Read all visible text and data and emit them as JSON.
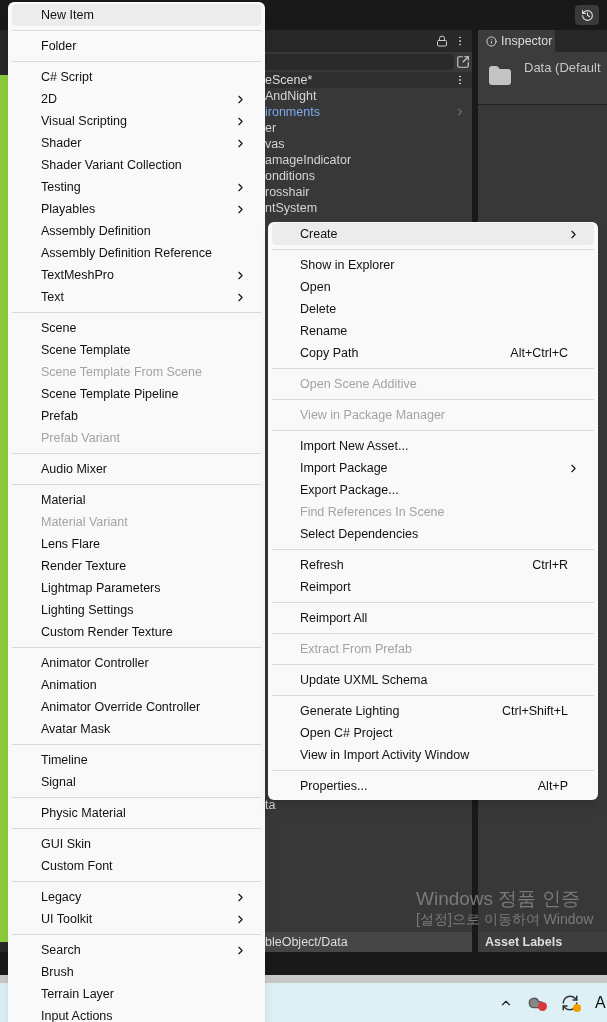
{
  "hierarchy": {
    "scene": "eScene*",
    "rows": [
      {
        "label": "AndNight",
        "kind": "object",
        "expandable": false
      },
      {
        "label": "ironments",
        "kind": "prefab",
        "expandable": true
      },
      {
        "label": "er",
        "kind": "object",
        "expandable": false
      },
      {
        "label": "vas",
        "kind": "object",
        "expandable": false
      },
      {
        "label": "amageIndicator",
        "kind": "object",
        "expandable": false
      },
      {
        "label": "onditions",
        "kind": "object",
        "expandable": false
      },
      {
        "label": "rosshair",
        "kind": "object",
        "expandable": false
      },
      {
        "label": "ntSystem",
        "kind": "object",
        "expandable": false
      }
    ],
    "lower_rows": [
      "ta"
    ],
    "path": "bleObject/Data"
  },
  "inspector": {
    "tab": "Inspector",
    "title": "Data (Default",
    "footer": "Asset Labels"
  },
  "activation_notice": [
    "Windows 정품 인증",
    "[설정]으로 이동하여 Window"
  ],
  "taskbar": {
    "clock_partial": "A"
  },
  "create_menu": [
    [
      {
        "label": "New Item",
        "highlighted": true,
        "disabled": false,
        "submenu": false
      }
    ],
    [
      {
        "label": "Folder",
        "highlighted": false,
        "disabled": false,
        "submenu": false
      }
    ],
    [
      {
        "label": "C# Script",
        "highlighted": false,
        "disabled": false,
        "submenu": false
      },
      {
        "label": "2D",
        "highlighted": false,
        "disabled": false,
        "submenu": true
      },
      {
        "label": "Visual Scripting",
        "highlighted": false,
        "disabled": false,
        "submenu": true
      },
      {
        "label": "Shader",
        "highlighted": false,
        "disabled": false,
        "submenu": true
      },
      {
        "label": "Shader Variant Collection",
        "highlighted": false,
        "disabled": false,
        "submenu": false
      },
      {
        "label": "Testing",
        "highlighted": false,
        "disabled": false,
        "submenu": true
      },
      {
        "label": "Playables",
        "highlighted": false,
        "disabled": false,
        "submenu": true
      },
      {
        "label": "Assembly Definition",
        "highlighted": false,
        "disabled": false,
        "submenu": false
      },
      {
        "label": "Assembly Definition Reference",
        "highlighted": false,
        "disabled": false,
        "submenu": false
      },
      {
        "label": "TextMeshPro",
        "highlighted": false,
        "disabled": false,
        "submenu": true
      },
      {
        "label": "Text",
        "highlighted": false,
        "disabled": false,
        "submenu": true
      }
    ],
    [
      {
        "label": "Scene",
        "highlighted": false,
        "disabled": false,
        "submenu": false
      },
      {
        "label": "Scene Template",
        "highlighted": false,
        "disabled": false,
        "submenu": false
      },
      {
        "label": "Scene Template From Scene",
        "highlighted": false,
        "disabled": true,
        "submenu": false
      },
      {
        "label": "Scene Template Pipeline",
        "highlighted": false,
        "disabled": false,
        "submenu": false
      },
      {
        "label": "Prefab",
        "highlighted": false,
        "disabled": false,
        "submenu": false
      },
      {
        "label": "Prefab Variant",
        "highlighted": false,
        "disabled": true,
        "submenu": false
      }
    ],
    [
      {
        "label": "Audio Mixer",
        "highlighted": false,
        "disabled": false,
        "submenu": false
      }
    ],
    [
      {
        "label": "Material",
        "highlighted": false,
        "disabled": false,
        "submenu": false
      },
      {
        "label": "Material Variant",
        "highlighted": false,
        "disabled": true,
        "submenu": false
      },
      {
        "label": "Lens Flare",
        "highlighted": false,
        "disabled": false,
        "submenu": false
      },
      {
        "label": "Render Texture",
        "highlighted": false,
        "disabled": false,
        "submenu": false
      },
      {
        "label": "Lightmap Parameters",
        "highlighted": false,
        "disabled": false,
        "submenu": false
      },
      {
        "label": "Lighting Settings",
        "highlighted": false,
        "disabled": false,
        "submenu": false
      },
      {
        "label": "Custom Render Texture",
        "highlighted": false,
        "disabled": false,
        "submenu": false
      }
    ],
    [
      {
        "label": "Animator Controller",
        "highlighted": false,
        "disabled": false,
        "submenu": false
      },
      {
        "label": "Animation",
        "highlighted": false,
        "disabled": false,
        "submenu": false
      },
      {
        "label": "Animator Override Controller",
        "highlighted": false,
        "disabled": false,
        "submenu": false
      },
      {
        "label": "Avatar Mask",
        "highlighted": false,
        "disabled": false,
        "submenu": false
      }
    ],
    [
      {
        "label": "Timeline",
        "highlighted": false,
        "disabled": false,
        "submenu": false
      },
      {
        "label": "Signal",
        "highlighted": false,
        "disabled": false,
        "submenu": false
      }
    ],
    [
      {
        "label": "Physic Material",
        "highlighted": false,
        "disabled": false,
        "submenu": false
      }
    ],
    [
      {
        "label": "GUI Skin",
        "highlighted": false,
        "disabled": false,
        "submenu": false
      },
      {
        "label": "Custom Font",
        "highlighted": false,
        "disabled": false,
        "submenu": false
      }
    ],
    [
      {
        "label": "Legacy",
        "highlighted": false,
        "disabled": false,
        "submenu": true
      },
      {
        "label": "UI Toolkit",
        "highlighted": false,
        "disabled": false,
        "submenu": true
      }
    ],
    [
      {
        "label": "Search",
        "highlighted": false,
        "disabled": false,
        "submenu": true
      },
      {
        "label": "Brush",
        "highlighted": false,
        "disabled": false,
        "submenu": false
      },
      {
        "label": "Terrain Layer",
        "highlighted": false,
        "disabled": false,
        "submenu": false
      },
      {
        "label": "Input Actions",
        "highlighted": false,
        "disabled": false,
        "submenu": false
      }
    ]
  ],
  "context_menu": [
    [
      {
        "label": "Create",
        "highlighted": true,
        "disabled": false,
        "submenu": true
      }
    ],
    [
      {
        "label": "Show in Explorer",
        "highlighted": false,
        "disabled": false,
        "submenu": false
      },
      {
        "label": "Open",
        "highlighted": false,
        "disabled": false,
        "submenu": false
      },
      {
        "label": "Delete",
        "highlighted": false,
        "disabled": false,
        "submenu": false
      },
      {
        "label": "Rename",
        "highlighted": false,
        "disabled": false,
        "submenu": false
      },
      {
        "label": "Copy Path",
        "highlighted": false,
        "disabled": false,
        "submenu": false,
        "shortcut": "Alt+Ctrl+C"
      }
    ],
    [
      {
        "label": "Open Scene Additive",
        "highlighted": false,
        "disabled": true,
        "submenu": false
      }
    ],
    [
      {
        "label": "View in Package Manager",
        "highlighted": false,
        "disabled": true,
        "submenu": false
      }
    ],
    [
      {
        "label": "Import New Asset...",
        "highlighted": false,
        "disabled": false,
        "submenu": false
      },
      {
        "label": "Import Package",
        "highlighted": false,
        "disabled": false,
        "submenu": true
      },
      {
        "label": "Export Package...",
        "highlighted": false,
        "disabled": false,
        "submenu": false
      },
      {
        "label": "Find References In Scene",
        "highlighted": false,
        "disabled": true,
        "submenu": false
      },
      {
        "label": "Select Dependencies",
        "highlighted": false,
        "disabled": false,
        "submenu": false
      }
    ],
    [
      {
        "label": "Refresh",
        "highlighted": false,
        "disabled": false,
        "submenu": false,
        "shortcut": "Ctrl+R"
      },
      {
        "label": "Reimport",
        "highlighted": false,
        "disabled": false,
        "submenu": false
      }
    ],
    [
      {
        "label": "Reimport All",
        "highlighted": false,
        "disabled": false,
        "submenu": false
      }
    ],
    [
      {
        "label": "Extract From Prefab",
        "highlighted": false,
        "disabled": true,
        "submenu": false
      }
    ],
    [
      {
        "label": "Update UXML Schema",
        "highlighted": false,
        "disabled": false,
        "submenu": false
      }
    ],
    [
      {
        "label": "Generate Lighting",
        "highlighted": false,
        "disabled": false,
        "submenu": false,
        "shortcut": "Ctrl+Shift+L"
      },
      {
        "label": "Open C# Project",
        "highlighted": false,
        "disabled": false,
        "submenu": false
      },
      {
        "label": "View in Import Activity Window",
        "highlighted": false,
        "disabled": false,
        "submenu": false
      }
    ],
    [
      {
        "label": "Properties...",
        "highlighted": false,
        "disabled": false,
        "submenu": false,
        "shortcut": "Alt+P"
      }
    ]
  ]
}
